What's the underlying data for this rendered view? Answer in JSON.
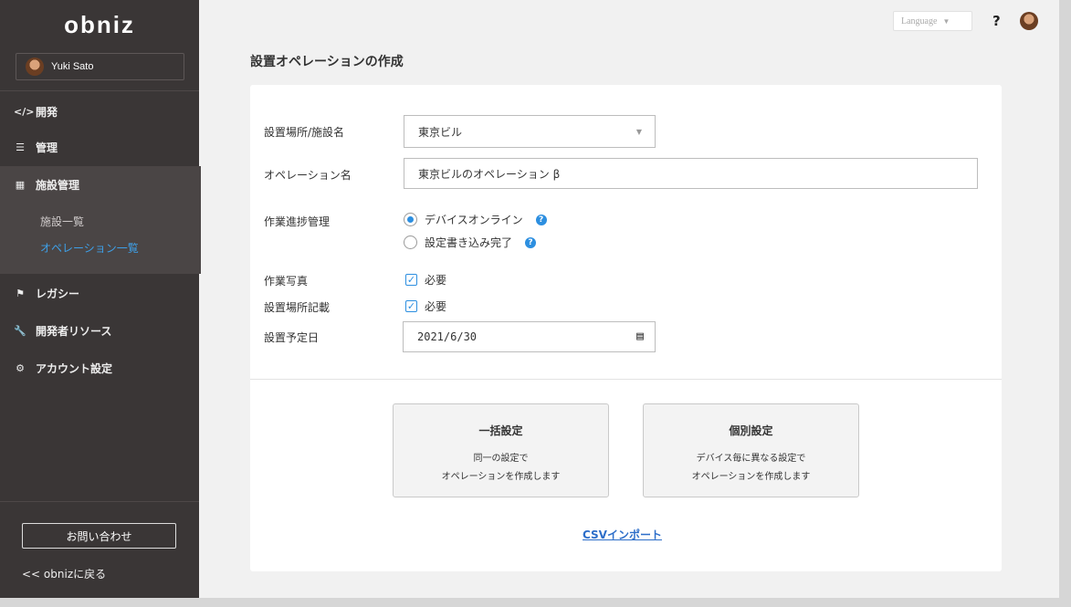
{
  "sidebar": {
    "logo": "obniz",
    "user_name": "Yuki Sato",
    "nav": [
      {
        "icon": "</>",
        "label": "開発"
      },
      {
        "icon": "☰",
        "label": "管理"
      },
      {
        "icon": "▦",
        "label": "施設管理"
      },
      {
        "icon": "⚑",
        "label": "レガシー"
      },
      {
        "icon": "🔧",
        "label": "開発者リソース"
      },
      {
        "icon": "⚙",
        "label": "アカウント設定"
      }
    ],
    "sub_items": [
      "施設一覧",
      "オペレーション一覧"
    ],
    "contact_label": "お問い合わせ",
    "back_label": "<< obnizに戻る"
  },
  "header": {
    "language_label": "Language",
    "help_label": "?"
  },
  "page": {
    "title": "設置オペレーションの作成"
  },
  "form": {
    "site_label": "設置場所/施設名",
    "site_value": "東京ビル",
    "op_name_label": "オペレーション名",
    "op_name_value": "東京ビルのオペレーション β",
    "progress_label": "作業進捗管理",
    "progress_options": [
      "デバイスオンライン",
      "設定書き込み完了"
    ],
    "progress_selected": 0,
    "photo_label": "作業写真",
    "photo_check": "必要",
    "location_label": "設置場所記載",
    "location_check": "必要",
    "date_label": "設置予定日",
    "date_value": "2021/6/30"
  },
  "options": [
    {
      "title": "一括設定",
      "desc1": "同一の設定で",
      "desc2": "オペレーションを作成します"
    },
    {
      "title": "個別設定",
      "desc1": "デバイス毎に異なる設定で",
      "desc2": "オペレーションを作成します"
    }
  ],
  "csv_label": "CSVインポート",
  "colors": {
    "sidebar_bg": "#3a3636",
    "accent": "#2d8fe0",
    "link": "#2d6ec9"
  }
}
